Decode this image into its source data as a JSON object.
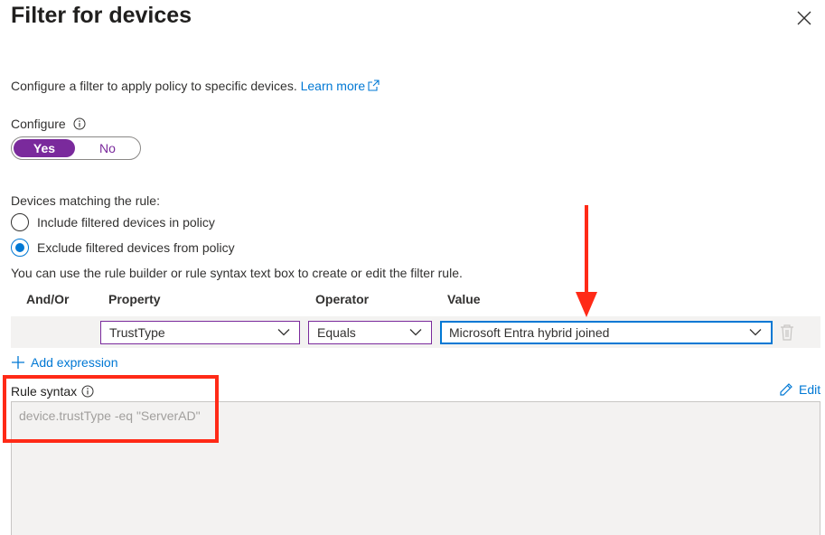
{
  "panel": {
    "title": "Filter for devices",
    "close_icon": "close-icon"
  },
  "description": {
    "text": "Configure a filter to apply policy to specific devices.",
    "learn_more": "Learn more",
    "external_icon": "external-link-icon"
  },
  "configure": {
    "label": "Configure",
    "info_icon": "info-icon",
    "options": [
      "Yes",
      "No"
    ],
    "selected": "Yes"
  },
  "devices_matching": {
    "label": "Devices matching the rule:",
    "options": [
      {
        "label": "Include filtered devices in policy",
        "selected": false
      },
      {
        "label": "Exclude filtered devices from policy",
        "selected": true
      }
    ]
  },
  "help_text": "You can use the rule builder or rule syntax text box to create or edit the filter rule.",
  "rule_builder": {
    "columns": [
      "And/Or",
      "Property",
      "Operator",
      "Value"
    ],
    "rows": [
      {
        "and_or": "",
        "property": "TrustType",
        "operator": "Equals",
        "value": "Microsoft Entra hybrid joined"
      }
    ],
    "delete_icon": "trash-icon",
    "add_expression": "Add expression",
    "add_icon": "plus-icon"
  },
  "rule_syntax": {
    "label": "Rule syntax",
    "info_icon": "info-icon",
    "edit_label": "Edit",
    "edit_icon": "pencil-icon",
    "value": "device.trustType -eq \"ServerAD\""
  },
  "colors": {
    "accent_purple": "#7a2a9c",
    "link_blue": "#0078d4",
    "annotation_red": "#ff2a17",
    "row_background": "#f3f2f1"
  }
}
